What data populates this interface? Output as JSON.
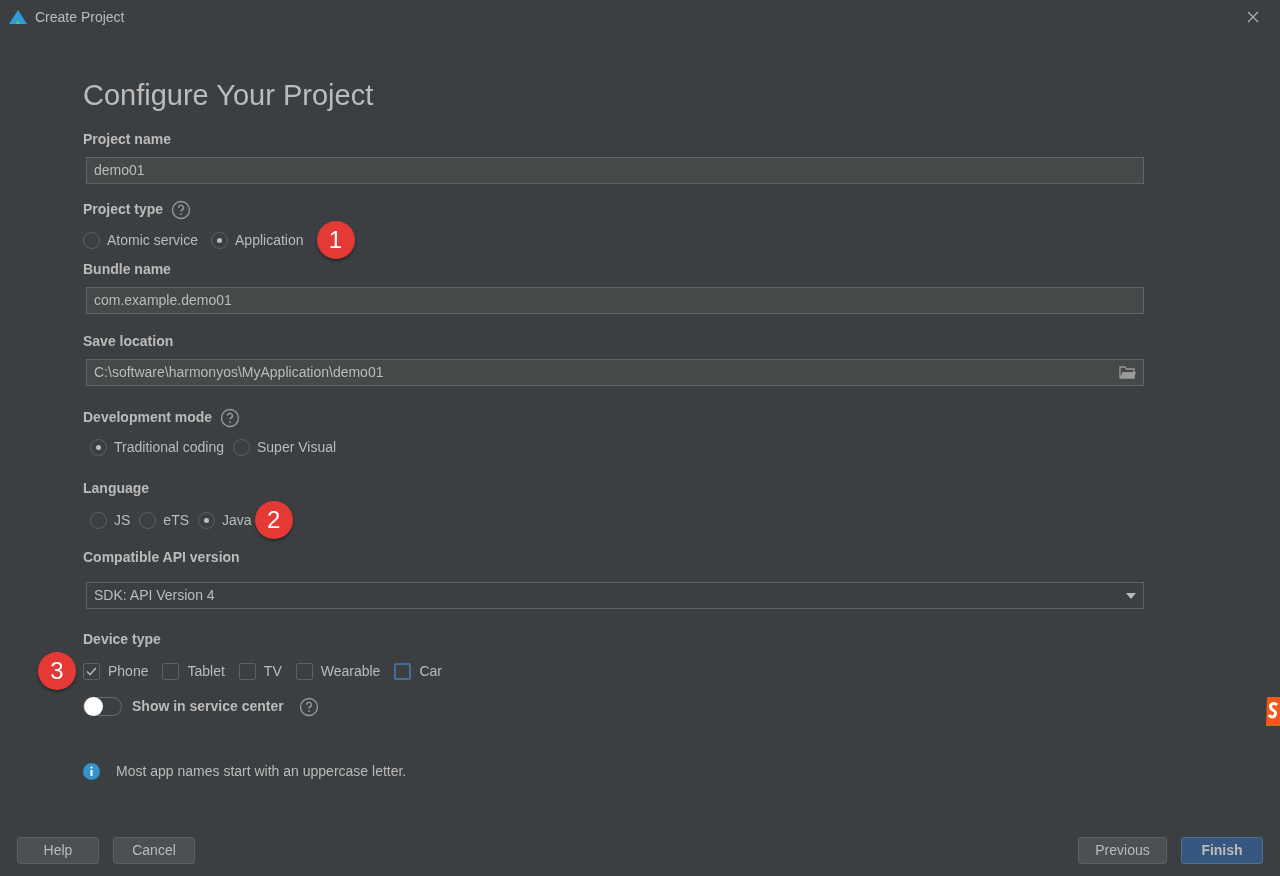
{
  "window": {
    "title": "Create Project"
  },
  "heading": "Configure Your Project",
  "project_name": {
    "label": "Project name",
    "value": "demo01"
  },
  "project_type": {
    "label": "Project type",
    "options": [
      {
        "label": "Atomic service",
        "selected": false
      },
      {
        "label": "Application",
        "selected": true
      }
    ],
    "marker": "1"
  },
  "bundle_name": {
    "label": "Bundle name",
    "value": "com.example.demo01"
  },
  "save_location": {
    "label": "Save location",
    "value": "C:\\software\\harmonyos\\MyApplication\\demo01"
  },
  "development_mode": {
    "label": "Development mode",
    "options": [
      {
        "label": "Traditional coding",
        "selected": true
      },
      {
        "label": "Super Visual",
        "selected": false
      }
    ]
  },
  "language": {
    "label": "Language",
    "options": [
      {
        "label": "JS",
        "selected": false
      },
      {
        "label": "eTS",
        "selected": false
      },
      {
        "label": "Java",
        "selected": true
      }
    ],
    "marker": "2"
  },
  "api_version": {
    "label": "Compatible API version",
    "value": "SDK: API Version 4"
  },
  "device_type": {
    "label": "Device type",
    "marker": "3",
    "options": [
      {
        "label": "Phone",
        "checked": true,
        "focused": false
      },
      {
        "label": "Tablet",
        "checked": false,
        "focused": false
      },
      {
        "label": "TV",
        "checked": false,
        "focused": false
      },
      {
        "label": "Wearable",
        "checked": false,
        "focused": false
      },
      {
        "label": "Car",
        "checked": false,
        "focused": true
      }
    ]
  },
  "service_center": {
    "label": "Show in service center",
    "on": false
  },
  "info": "Most app names start with an uppercase letter.",
  "buttons": [
    {
      "label": "Help",
      "kind": "plain"
    },
    {
      "label": "Cancel",
      "kind": "plain"
    },
    {
      "label": "Previous",
      "kind": "plain"
    },
    {
      "label": "Finish",
      "kind": "primary"
    }
  ]
}
